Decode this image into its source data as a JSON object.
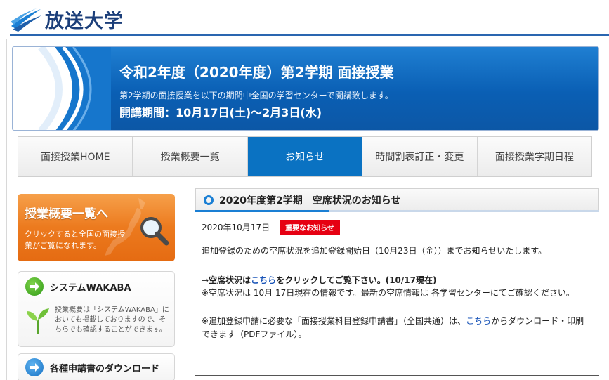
{
  "header": {
    "logo_text": "放送大学",
    "logo_icon": "university-swoosh-logo"
  },
  "banner": {
    "title": "令和2年度（2020年度）第2学期 面接授業",
    "description": "第2学期の面接授業を以下の期間中全国の学習センターで開講致します。",
    "period": "開講期間：10月17日(土)～2月3日(水)"
  },
  "tabs": [
    {
      "label": "面接授業HOME",
      "active": false
    },
    {
      "label": "授業概要一覧",
      "active": false
    },
    {
      "label": "お知らせ",
      "active": true
    },
    {
      "label": "時間割表訂正・変更",
      "active": false
    },
    {
      "label": "面接授業学期日程",
      "active": false
    }
  ],
  "sidebar": {
    "promo": {
      "title": "授業概要一覧へ",
      "subtitle": "クリックすると全国の面接授業がご覧になれます。",
      "icon": "magnifier-icon"
    },
    "wakaba": {
      "label": "システムWAKABA",
      "description": "授業概要は「システムWAKABA」においても掲載しておりますので、そちらでも確認することができます。",
      "icon": "arrow-right-icon"
    },
    "download": {
      "label": "各種申請書のダウンロード",
      "icon": "arrow-right-icon"
    }
  },
  "article": {
    "title": "2020年度第2学期　空席状況のお知らせ",
    "date": "2020年10月17日",
    "badge": "重要なお知らせ",
    "p1": "追加登録のための空席状況を追加登録開始日（10月23日（金））までお知らせいたします。",
    "p2_pre": "→空席状況は",
    "p2_link": "こちら",
    "p2_post": "をクリックしてご覧下さい。(10/17現在)",
    "p3": "※空席状況は 10月 17日現在の情報です。最新の空席情報は 各学習センターにてご確認ください。",
    "p4_pre": "※追加登録申請に必要な「面接授業科目登録申請書」（全国共通）は、",
    "p4_link": "こちら",
    "p4_post": "からダウンロード・印刷",
    "p5": "できます（PDFファイル）。"
  },
  "colors": {
    "brand_blue": "#0a72c2",
    "accent_orange": "#ec7a1e",
    "badge_red": "#e60012",
    "link": "#1a55b8"
  }
}
